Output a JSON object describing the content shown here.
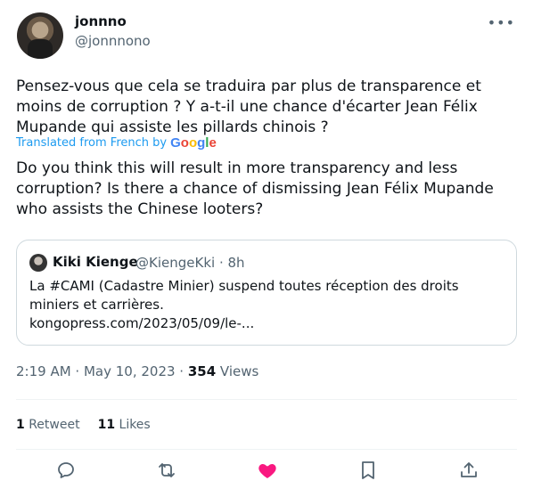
{
  "author": {
    "name": "jonnno",
    "handle": "@jonnnono"
  },
  "more_label": "•••",
  "tweet": {
    "text_original": "Pensez-vous que cela se traduira par plus de transparence et moins de corruption ? Y a-t-il une chance d'écarter Jean Félix Mupande qui assiste les pillards chinois ?",
    "translated_label": "Translated from French by",
    "translation_provider": "Google",
    "text_translated": "Do you think this will result in more transparency and less corruption? Is there a chance of dismissing Jean Félix Mupande who assists the Chinese looters?"
  },
  "quoted": {
    "name": "Kiki Kienge",
    "meta": "@KiengeKki · 8h",
    "text": "La #CAMI (Cadastre Minier) suspend toutes réception des droits miniers et carrières.",
    "link": "kongopress.com/2023/05/09/le-..."
  },
  "timeline": {
    "time": "2:19 AM · May 10, 2023 · ",
    "views_count": "354",
    "views_label": " Views"
  },
  "stats": {
    "retweets_count": "1",
    "retweets_label": " Retweet",
    "likes_count": "11",
    "likes_label": " Likes"
  },
  "colors": {
    "accent": "#1d9bf0",
    "like": "#f91880",
    "secondary_text": "#536471"
  },
  "icons": [
    "reply-icon",
    "retweet-icon",
    "like-icon",
    "bookmark-icon",
    "share-icon"
  ]
}
